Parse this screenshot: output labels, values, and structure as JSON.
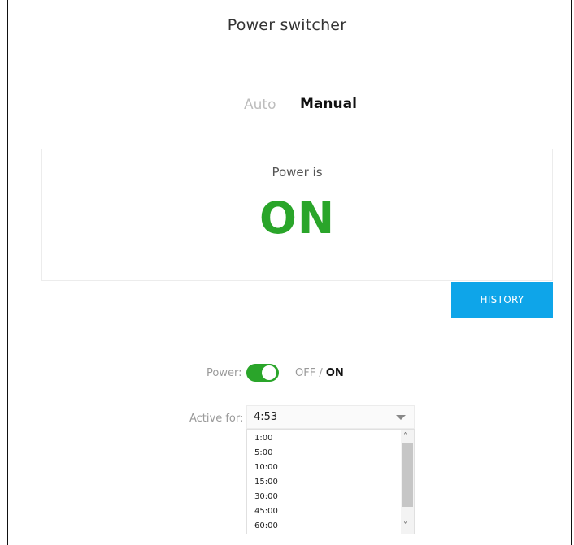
{
  "page": {
    "title": "Power switcher"
  },
  "modes": {
    "auto": "Auto",
    "manual": "Manual",
    "selected": "Manual"
  },
  "status": {
    "label": "Power is",
    "value": "ON",
    "color": "#2aa52a"
  },
  "history_button": {
    "label": "HISTORY",
    "color": "#0ea5e9"
  },
  "power_control": {
    "label": "Power:",
    "off_text": "OFF",
    "separator": " / ",
    "on_text": "ON",
    "toggle_on": true
  },
  "active_for": {
    "label": "Active for:",
    "value": "4:53",
    "options": [
      "1:00",
      "5:00",
      "10:00",
      "15:00",
      "30:00",
      "45:00",
      "60:00"
    ]
  },
  "icons": {
    "dropdown": "chevron-down-icon",
    "scroll_up": "chevron-up-icon",
    "scroll_down": "chevron-down-icon"
  }
}
